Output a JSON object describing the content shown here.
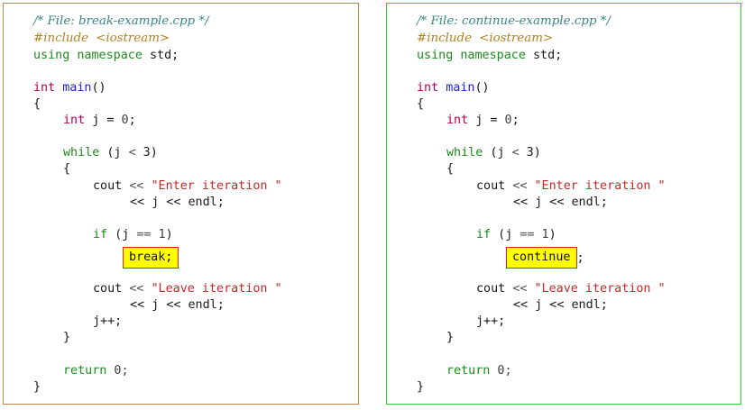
{
  "left": {
    "comment": "/* File: break-example.cpp */",
    "include_directive": "#include",
    "include_header": "<iostream>",
    "using_kw": "using namespace",
    "using_rest": " std;",
    "main_type": "int",
    "main_name": "main",
    "main_paren": "()",
    "open_brace": "{",
    "decl_type": "int",
    "decl_rest": " j = ",
    "decl_num": "0",
    "semi": ";",
    "while_kw": "while",
    "while_cond": " (j ",
    "lt": "<",
    "three": " 3)",
    "inner_open": "{",
    "cout1": "cout ",
    "shl": "<<",
    "enter_str": " \"Enter iteration \"",
    "cont1_a": "<< j << endl;",
    "if_kw": "if",
    "if_cond_a": " (j ",
    "eqeq": "==",
    "one": " 1",
    "if_close": ")",
    "highlight": "break;",
    "highlight_after": "",
    "cout2": "cout ",
    "leave_str": " \"Leave iteration \"",
    "cont2_a": "<< j << endl;",
    "incr": "j++;",
    "inner_close": "}",
    "return_kw": "return",
    "return_num": " 0;",
    "close_brace": "}"
  },
  "right": {
    "comment": "/* File: continue-example.cpp */",
    "include_directive": "#include",
    "include_header": "<iostream>",
    "using_kw": "using namespace",
    "using_rest": " std;",
    "main_type": "int",
    "main_name": "main",
    "main_paren": "()",
    "open_brace": "{",
    "decl_type": "int",
    "decl_rest": " j = ",
    "decl_num": "0",
    "semi": ";",
    "while_kw": "while",
    "while_cond": " (j ",
    "lt": "<",
    "three": " 3)",
    "inner_open": "{",
    "cout1": "cout ",
    "shl": "<<",
    "enter_str": " \"Enter iteration \"",
    "cont1_a": "<< j << endl;",
    "if_kw": "if",
    "if_cond_a": " (j ",
    "eqeq": "==",
    "one": " 1",
    "if_close": ")",
    "highlight": "continue",
    "highlight_after": ";",
    "cout2": "cout ",
    "leave_str": " \"Leave iteration \"",
    "cont2_a": "<< j << endl;",
    "incr": "j++;",
    "inner_close": "}",
    "return_kw": "return",
    "return_num": " 0;",
    "close_brace": "}"
  }
}
